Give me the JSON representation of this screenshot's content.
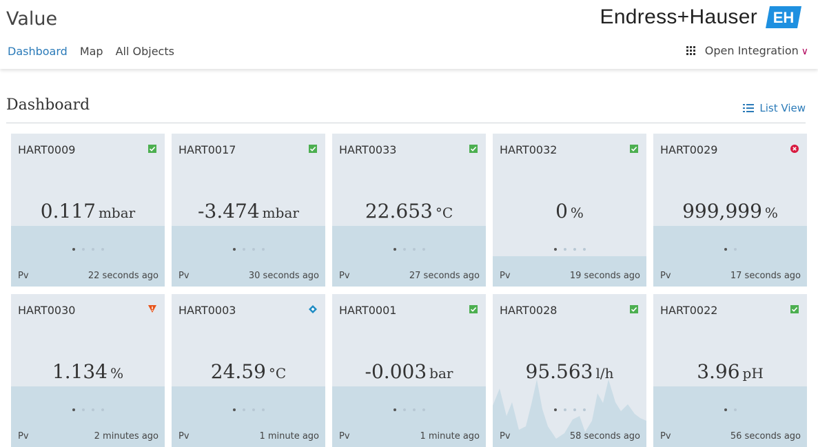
{
  "app": {
    "title": "Value"
  },
  "nav": {
    "items": [
      "Dashboard",
      "Map",
      "All Objects"
    ],
    "active": 0
  },
  "brand": {
    "name": "Endress+Hauser",
    "logo_text": "EH",
    "color": "#1e90e0"
  },
  "header": {
    "integration_label": "Open Integration",
    "chevron": "chevron-down"
  },
  "section": {
    "title": "Dashboard",
    "list_view_label": "List View"
  },
  "colors": {
    "ok": "#4caf50",
    "error": "#d81b40",
    "warning": "#e8541a",
    "info": "#1e8bc3",
    "accent": "#2a7ab8"
  },
  "tiles": [
    {
      "name": "HART0009",
      "status": "ok",
      "value": "0.117",
      "unit": "mbar",
      "variable": "Pv",
      "ago": "22 seconds ago"
    },
    {
      "name": "HART0017",
      "status": "ok",
      "value": "-3.474",
      "unit": "mbar",
      "variable": "Pv",
      "ago": "30 seconds ago"
    },
    {
      "name": "HART0033",
      "status": "ok",
      "value": "22.653",
      "unit": "°C",
      "variable": "Pv",
      "ago": "27 seconds ago"
    },
    {
      "name": "HART0032",
      "status": "ok",
      "value": "0",
      "unit": "%",
      "variable": "Pv",
      "ago": "19 seconds ago"
    },
    {
      "name": "HART0029",
      "status": "error",
      "value": "999,999",
      "unit": "%",
      "variable": "Pv",
      "ago": "17 seconds ago"
    },
    {
      "name": "HART0030",
      "status": "warning",
      "value": "1.134",
      "unit": "%",
      "variable": "Pv",
      "ago": "2 minutes ago"
    },
    {
      "name": "HART0003",
      "status": "info",
      "value": "24.59",
      "unit": "°C",
      "variable": "Pv",
      "ago": "1 minute ago"
    },
    {
      "name": "HART0001",
      "status": "ok",
      "value": "-0.003",
      "unit": "bar",
      "variable": "Pv",
      "ago": "1 minute ago"
    },
    {
      "name": "HART0028",
      "status": "ok",
      "value": "95.563",
      "unit": "l/h",
      "variable": "Pv",
      "ago": "58 seconds ago"
    },
    {
      "name": "HART0022",
      "status": "ok",
      "value": "3.96",
      "unit": "pH",
      "variable": "Pv",
      "ago": "56 seconds ago"
    }
  ]
}
